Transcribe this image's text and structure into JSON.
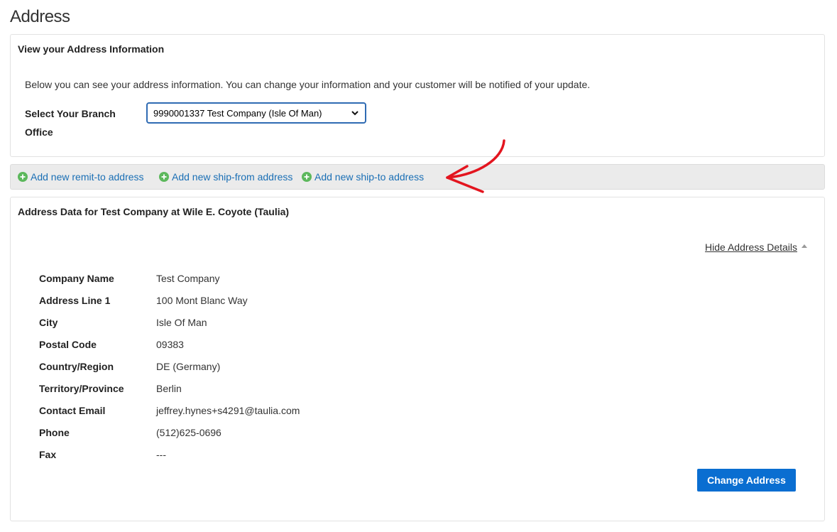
{
  "page": {
    "title": "Address"
  },
  "info_panel": {
    "title": "View your Address Information",
    "intro": "Below you can see your address information. You can change your information and your customer will be notified of your update.",
    "branch_label": "Select Your Branch Office",
    "branch_selected": "9990001337 Test Company (Isle Of Man)"
  },
  "actions": {
    "remit_to": "Add new remit-to address",
    "ship_from": "Add new ship-from address",
    "ship_to": "Add new ship-to address"
  },
  "address_panel": {
    "title": "Address Data for Test Company at Wile E. Coyote (Taulia)",
    "toggle": "Hide Address Details",
    "fields": [
      {
        "label": "Company Name",
        "value": "Test Company"
      },
      {
        "label": "Address Line 1",
        "value": "100 Mont Blanc Way"
      },
      {
        "label": "City",
        "value": "Isle Of Man"
      },
      {
        "label": "Postal Code",
        "value": "09383"
      },
      {
        "label": "Country/Region",
        "value": "DE (Germany)"
      },
      {
        "label": "Territory/Province",
        "value": "Berlin"
      },
      {
        "label": "Contact Email",
        "value": "jeffrey.hynes+s4291@taulia.com"
      },
      {
        "label": "Phone",
        "value": "(512)625-0696"
      },
      {
        "label": "Fax",
        "value": "---"
      }
    ],
    "change_button": "Change Address"
  },
  "colors": {
    "link": "#1a6fb5",
    "primary_button": "#0a6ed1",
    "plus_icon": "#5cb85c",
    "arrow": "#e3151f"
  }
}
